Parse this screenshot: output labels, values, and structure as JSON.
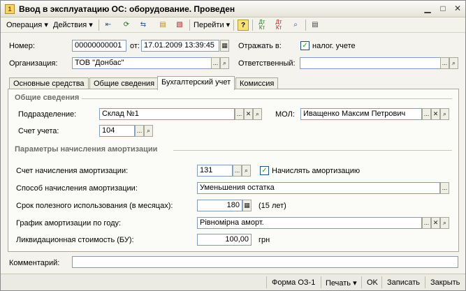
{
  "window": {
    "title": "Ввод в эксплуатацию ОС: оборудование. Проведен",
    "buttons": {
      "minimize": "▁",
      "maximize": "□",
      "close": "✕"
    }
  },
  "toolbar": {
    "operation": "Операция ▾",
    "actions": "Действия ▾",
    "goto": "Перейти ▾",
    "help_icon": "?"
  },
  "header": {
    "number_label": "Номер:",
    "number_value": "00000000001",
    "date_label": "от:",
    "date_value": "17.01.2009 13:39:45",
    "reflect_label": "Отражать в:",
    "tax_label": "налог. учете",
    "tax_checked": "✓",
    "org_label": "Организация:",
    "org_value": "ТОВ \"Донбас\"",
    "resp_label": "Ответственный:",
    "resp_value": ""
  },
  "tabs": [
    "Основные средства",
    "Общие сведения",
    "Бухгалтерский учет",
    "Комиссия"
  ],
  "general": {
    "section_title": "Общие сведения",
    "division_label": "Подразделение:",
    "division_value": "Склад №1",
    "mol_label": "МОЛ:",
    "mol_value": "Иващенко Максим Петрович",
    "account_label": "Счет учета:",
    "account_value": "104"
  },
  "amort": {
    "section_title": "Параметры начисления амортизации",
    "acc_label": "Счет начисления амортизации:",
    "acc_value": "131",
    "charge_label": "Начислять амортизацию",
    "charge_checked": "✓",
    "method_label": "Способ начисления амортизации:",
    "method_value": "Уменьшения остатка",
    "term_label": "Срок полезного использования (в месяцах):",
    "term_value": "180",
    "term_years": "(15 лет)",
    "schedule_label": "График амортизации по году:",
    "schedule_value": "Рівномірна аморт.",
    "liquid_label": "Ликвидационная стоимость (БУ):",
    "liquid_value": "100,00",
    "currency": "грн"
  },
  "comment": {
    "label": "Комментарий:",
    "value": ""
  },
  "statusbar": {
    "form": "Форма ОЗ-1",
    "print": "Печать ▾",
    "ok": "OK",
    "save": "Записать",
    "close": "Закрыть"
  },
  "icons": {
    "ellipsis": "...",
    "search": "🔍",
    "clear": "✕",
    "calendar": "▦",
    "calculator": "▦"
  }
}
